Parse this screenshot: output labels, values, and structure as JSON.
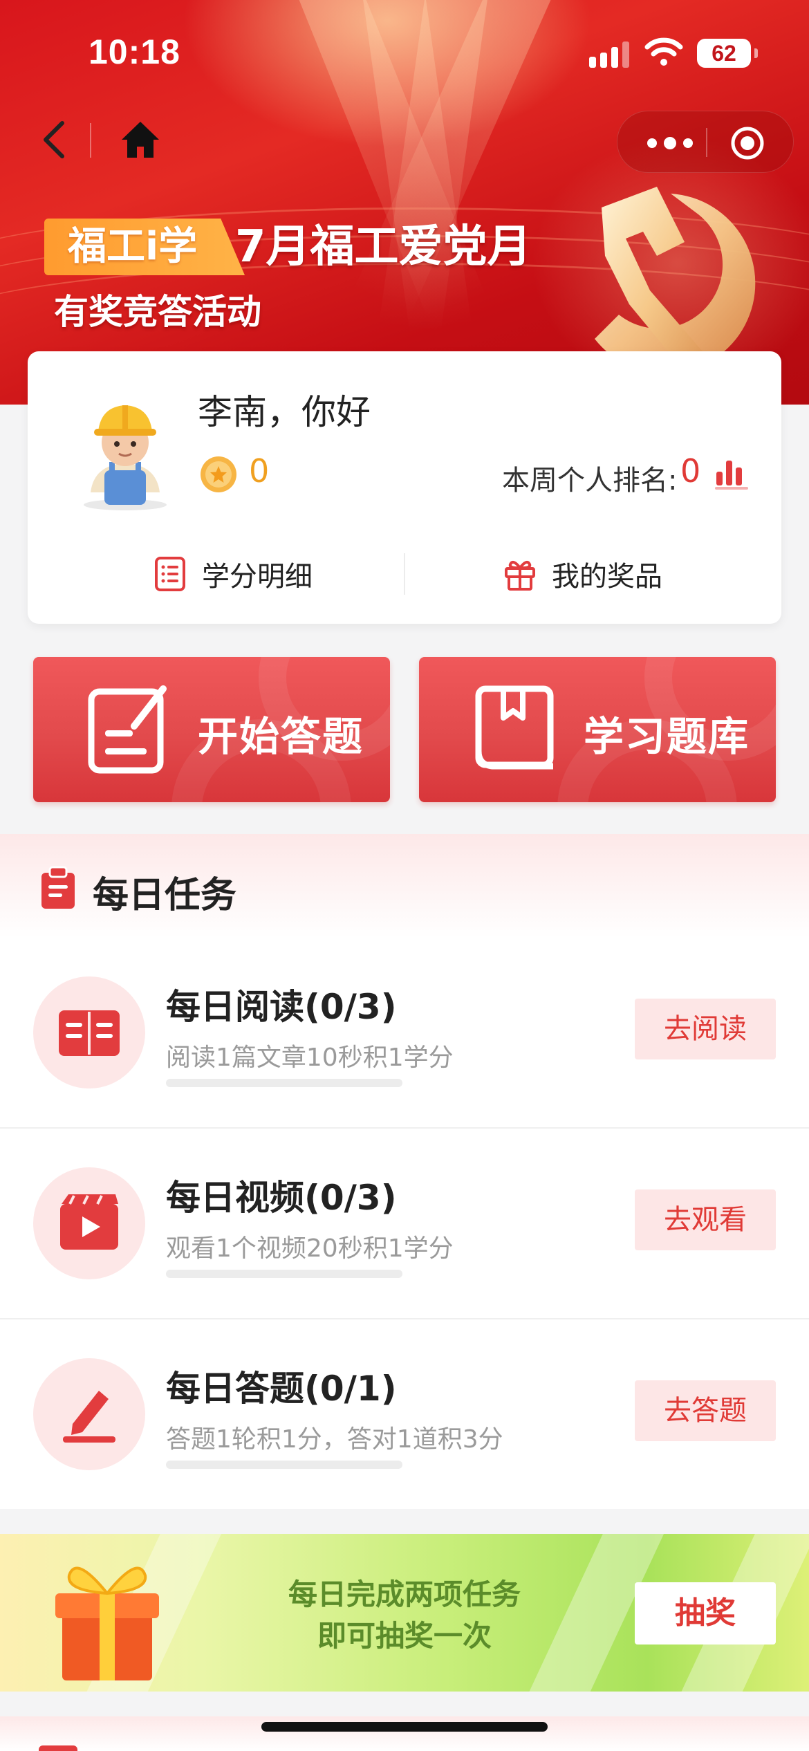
{
  "status_bar": {
    "time": "10:18",
    "battery": "62"
  },
  "banner": {
    "tag": "福工i学",
    "title": "7月福工爱党月",
    "subtitle": "有奖竞答活动"
  },
  "user": {
    "greeting": "李南，你好",
    "points": "0",
    "rank_label": "本周个人排名:",
    "rank_value": "0",
    "links": {
      "credits_detail": "学分明细",
      "my_prizes": "我的奖品"
    }
  },
  "actions": {
    "start_quiz": "开始答题",
    "question_bank": "学习题库"
  },
  "daily_tasks": {
    "title": "每日任务",
    "items": [
      {
        "name": "每日阅读(0/3)",
        "desc": "阅读1篇文章10秒积1学分",
        "button": "去阅读",
        "icon": "book-icon",
        "progress": 0
      },
      {
        "name": "每日视频(0/3)",
        "desc": "观看1个视频20秒积1学分",
        "button": "去观看",
        "icon": "video-icon",
        "progress": 0
      },
      {
        "name": "每日答题(0/1)",
        "desc": "答题1轮积1分，答对1道积3分",
        "button": "去答题",
        "icon": "pencil-icon",
        "progress": 0
      }
    ]
  },
  "lottery": {
    "line1": "每日完成两项任务",
    "line2": "即可抽奖一次",
    "button": "抽奖"
  },
  "colors": {
    "primary_red": "#e23c3e",
    "hero_red": "#d8161c",
    "coin_orange": "#f0a020",
    "lottery_green_text": "#5b8c2a"
  }
}
